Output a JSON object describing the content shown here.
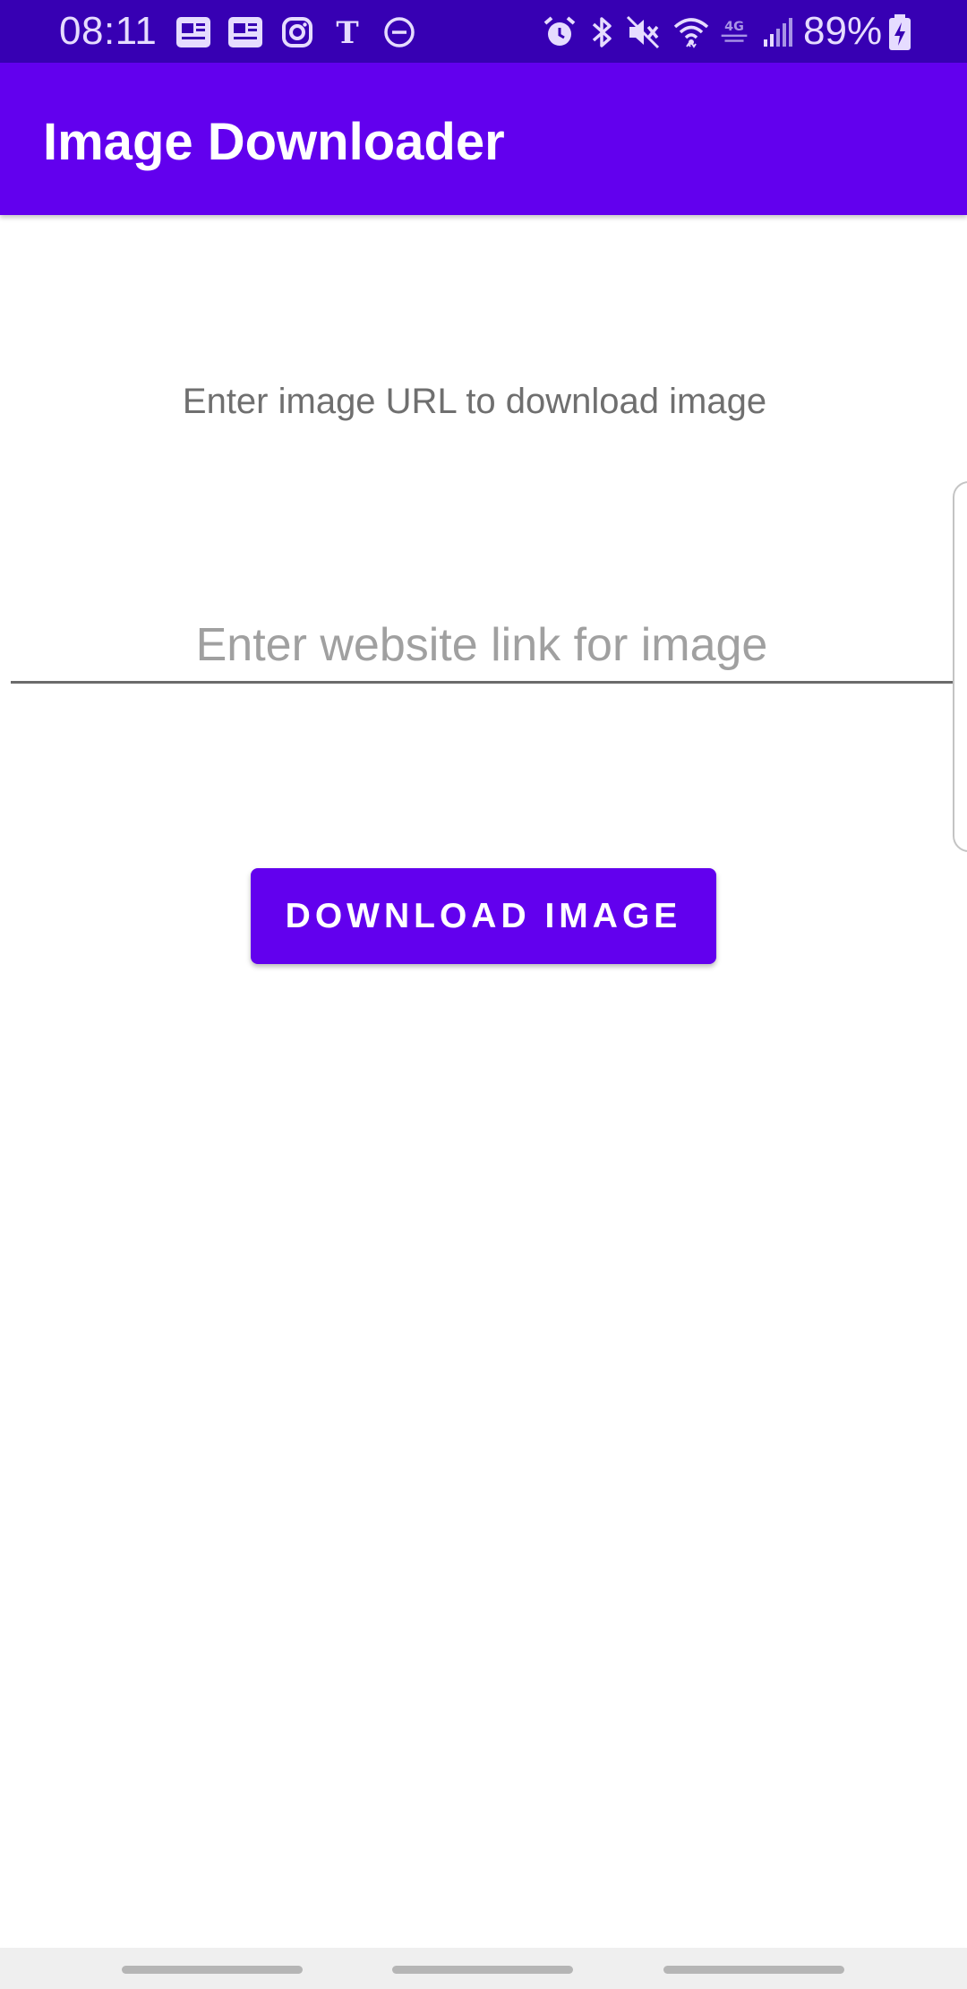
{
  "status_bar": {
    "time": "08:11",
    "battery_percent": "89%",
    "notification_icons": [
      "news-icon",
      "news-icon",
      "instagram-icon",
      "nytimes-icon",
      "do-not-disturb-icon"
    ],
    "system_icons": [
      "alarm-icon",
      "bluetooth-icon",
      "mute-icon",
      "wifi-icon",
      "lte-icon",
      "signal-icon",
      "battery-charging-icon"
    ]
  },
  "app_bar": {
    "title": "Image Downloader"
  },
  "main": {
    "instruction": "Enter image URL to download image",
    "url_input": {
      "value": "",
      "placeholder": "Enter website link for image"
    },
    "download_button_label": "DOWNLOAD IMAGE"
  },
  "colors": {
    "status_bar": "#3700b3",
    "primary": "#6200ee",
    "hint_text": "#a0a0a0",
    "body_text": "#6f6f6f"
  }
}
